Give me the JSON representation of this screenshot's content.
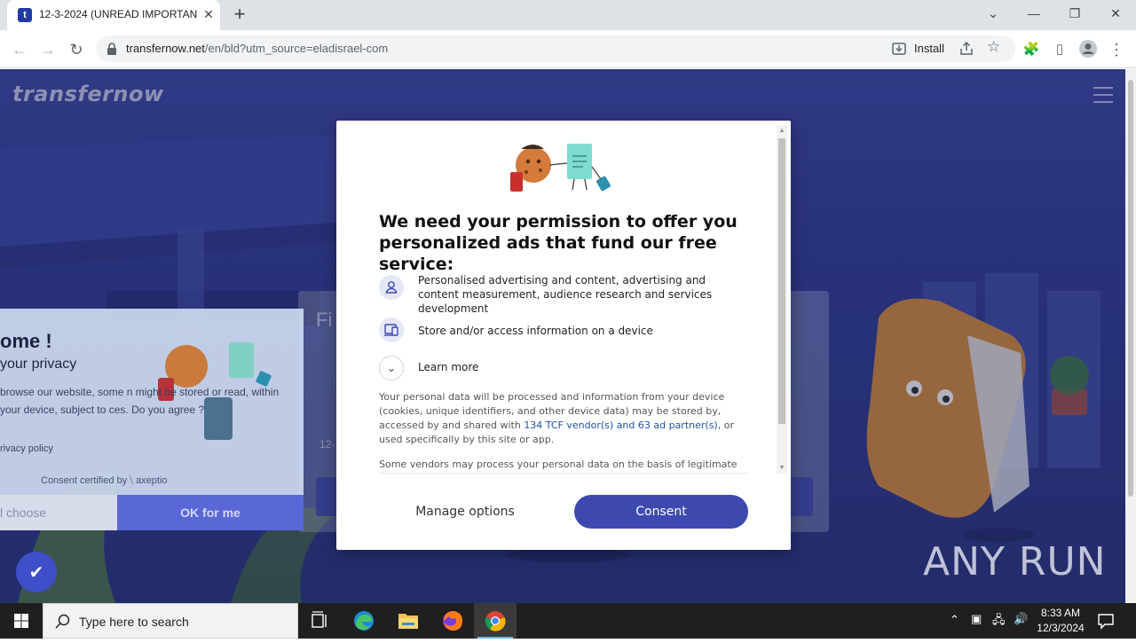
{
  "browser": {
    "tab_title": "12-3-2024 (UNREAD IMPORTANT",
    "favicon_letter": "t",
    "url_host": "transfernow.net",
    "url_path": "/en/bld?utm_source=eladisrael-com",
    "install_label": "Install"
  },
  "page": {
    "logo": "transfernow",
    "bg_card": {
      "welcome": "ome !",
      "privacy": "your privacy",
      "text": "browse our website, some n might be stored or read, within your device, subject to ces. Do you agree ?",
      "policy": "rivacy policy",
      "certified": "Consent certified by ⧹ axeptio",
      "choose": "l choose",
      "ok": "OK for me"
    },
    "bg_form": {
      "title": "Fi",
      "date": "12-"
    },
    "watermark": "ANY RUN"
  },
  "dialog": {
    "title": "We need your permission to offer you personalized ads that fund our free service:",
    "purposes": [
      {
        "icon": "person-icon",
        "text": "Personalised advertising and content, advertising and content measurement, audience research and services development"
      },
      {
        "icon": "device-icon",
        "text": "Store and/or access information on a device"
      }
    ],
    "learn_more": "Learn more",
    "desc_before": "Your personal data will be processed and information from your device (cookies, unique identifiers, and other device data) may be stored by, accessed by and shared with ",
    "desc_link": "134 TCF vendor(s) and 63 ad partner(s)",
    "desc_after": ", or used specifically by this site or app.",
    "more_text": "Some vendors may process your personal data on the basis of legitimate",
    "manage_label": "Manage options",
    "consent_label": "Consent"
  },
  "taskbar": {
    "search_placeholder": "Type here to search",
    "time": "8:33 AM",
    "date": "12/3/2024"
  },
  "colors": {
    "accent": "#3c4ab0",
    "link": "#1f4fa8",
    "page_bg": "#2e3a96"
  }
}
